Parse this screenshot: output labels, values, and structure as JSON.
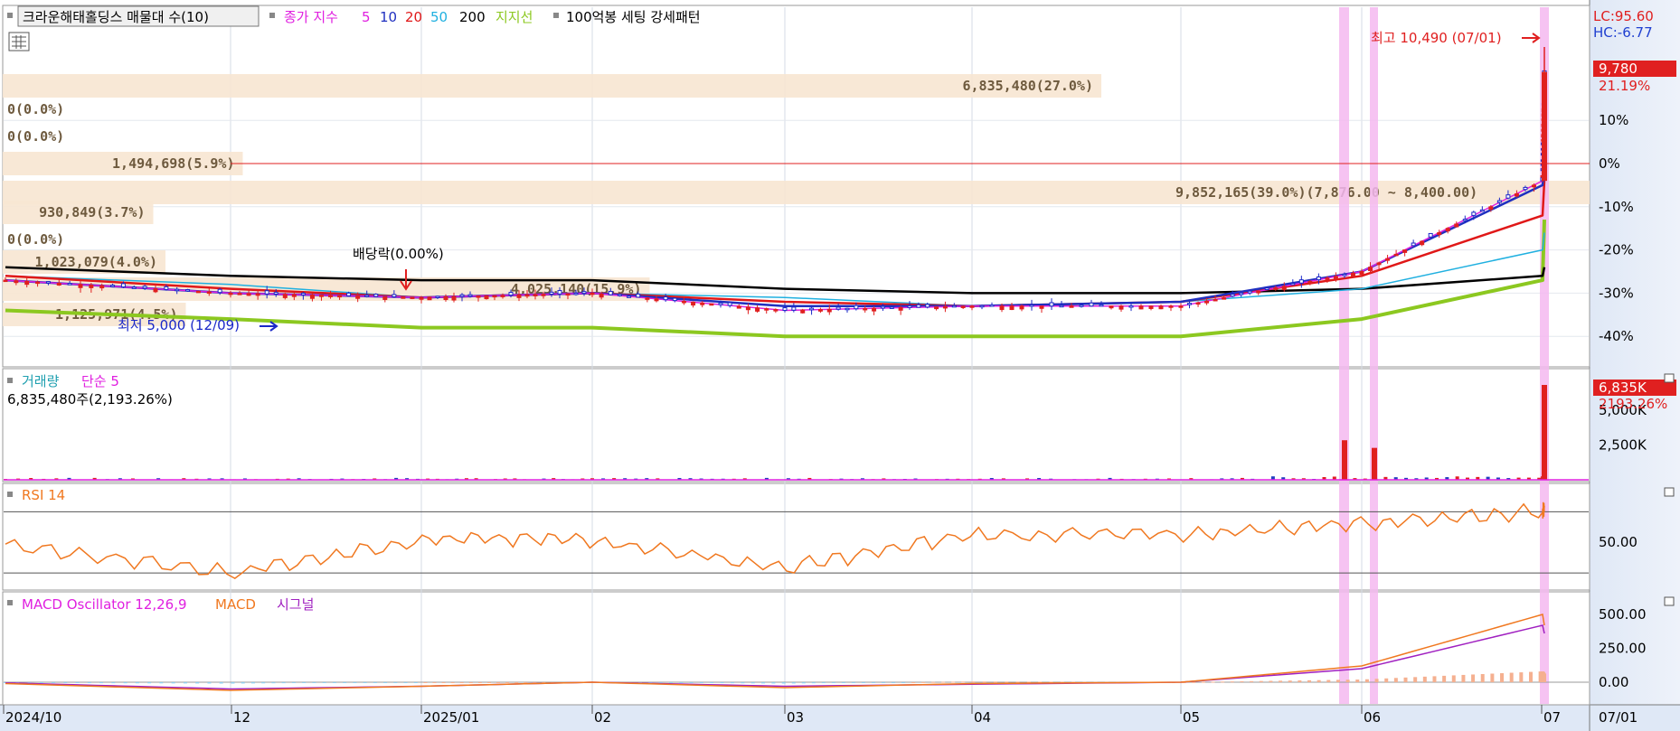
{
  "header": {
    "stock_name": "크라운해태홀딩스 매물대 수(10)",
    "ma_label": "종가 지수",
    "ma_periods": [
      {
        "label": "5",
        "color": "#e020e0"
      },
      {
        "label": "10",
        "color": "#2030c0"
      },
      {
        "label": "20",
        "color": "#e01818"
      },
      {
        "label": "50",
        "color": "#20b0e0"
      },
      {
        "label": "200",
        "color": "#000000"
      }
    ],
    "support_label": "지지선",
    "support_color": "#8cc820",
    "pattern_label": "100억봉 세팅 강세패턴"
  },
  "price_panel": {
    "lc_label": "LC:95.60",
    "hc_label": "HC:-6.77",
    "current_price": "9,780",
    "current_pct": "21.19%",
    "high_note": "최고 10,490 (07/01)",
    "low_note": "최저 5,000 (12/09)",
    "dividend_note": "배당락(0.00%)",
    "pct_ticks": [
      {
        "label": "10%",
        "v": 10
      },
      {
        "label": "0%",
        "v": 0
      },
      {
        "label": "-10%",
        "v": -10
      },
      {
        "label": "-20%",
        "v": -20
      },
      {
        "label": "-30%",
        "v": -30
      },
      {
        "label": "-40%",
        "v": -40
      }
    ],
    "volume_profile": [
      {
        "label": "6,835,480(27.0%)",
        "pct": 27.0
      },
      {
        "label": "0(0.0%)",
        "pct": 0.0
      },
      {
        "label": "0(0.0%)",
        "pct": 0.0
      },
      {
        "label": "1,494,698(5.9%)",
        "pct": 5.9
      },
      {
        "label": "9,852,165(39.0%)(7,876.00 ~ 8,400.00)",
        "pct": 39.0
      },
      {
        "label": "930,849(3.7%)",
        "pct": 3.7
      },
      {
        "label": "0(0.0%)",
        "pct": 0.0
      },
      {
        "label": "1,023,079(4.0%)",
        "pct": 4.0
      },
      {
        "label": "4,025,140(15.9%)",
        "pct": 15.9
      },
      {
        "label": "1,125,971(4.5%)",
        "pct": 4.5
      }
    ]
  },
  "volume_panel": {
    "title": "거래량",
    "ma_label": "단순 5",
    "value_text": "6,835,480주(2,193.26%)",
    "last_value": "6,835K",
    "last_pct": "2193.26%",
    "ticks": [
      {
        "label": "5,000K",
        "v": 5000
      },
      {
        "label": "2,500K",
        "v": 2500
      }
    ]
  },
  "rsi_panel": {
    "title": "RSI 14",
    "ticks": [
      {
        "label": "50.00",
        "v": 50
      }
    ]
  },
  "macd_panel": {
    "osc_label": "MACD Oscillator 12,26,9",
    "macd_label": "MACD",
    "signal_label": "시그널",
    "ticks": [
      {
        "label": "500.00",
        "v": 500
      },
      {
        "label": "250.00",
        "v": 250
      },
      {
        "label": "0.00",
        "v": 0
      }
    ]
  },
  "x_axis": {
    "labels": [
      "2024/10",
      "12",
      "2025/01",
      "02",
      "03",
      "04",
      "05",
      "06",
      "07"
    ],
    "right_label": "07/01"
  },
  "chart_data": {
    "type": "candlestick",
    "title": "크라운해태홀딩스",
    "x_range": [
      "2024/10",
      "2025/07/01"
    ],
    "price_pct_ylim": [
      -45,
      20
    ],
    "price_pct_ref_0": 8070,
    "price_series": {
      "months": [
        "2024/10",
        "2024/11",
        "2024/12",
        "2025/01",
        "2025/02",
        "2025/03",
        "2025/04",
        "2025/05",
        "2025/06",
        "2025/07"
      ],
      "close_pct": [
        -27,
        -30,
        -31,
        -30,
        -34,
        -33,
        -33,
        -25,
        -4,
        21
      ],
      "ma5_pct": [
        -27,
        -30,
        -31,
        -30,
        -33,
        -33,
        -32,
        -25,
        -5,
        0
      ],
      "ma20_pct": [
        -26,
        -29,
        -31,
        -30,
        -32,
        -33,
        -32,
        -26,
        -12,
        -4
      ],
      "ma50_pct": [
        -26,
        -28,
        -31,
        -30,
        -31,
        -33,
        -32,
        -29,
        -20,
        -16
      ],
      "ma200_pct": [
        -24,
        -26,
        -27,
        -27,
        -29,
        -30,
        -30,
        -29,
        -26,
        -24
      ],
      "support_pct": [
        -34,
        -36,
        -38,
        -38,
        -40,
        -40,
        -40,
        -36,
        -27,
        -13
      ]
    },
    "volume_series": {
      "unit": "K shares",
      "ylim": [
        0,
        6900
      ],
      "ma5_last": 300,
      "spikes": [
        {
          "date": "2025/05/28",
          "v": 2850
        },
        {
          "date": "2025/06/04",
          "v": 2300
        },
        {
          "date": "2025/07/01",
          "v": 6835
        }
      ]
    },
    "rsi_series": {
      "ylim": [
        20,
        85
      ],
      "overbought": 70,
      "oversold": 30,
      "months": [
        "2024/10",
        "2024/11",
        "2024/12",
        "2025/01",
        "2025/02",
        "2025/03",
        "2025/04",
        "2025/05",
        "2025/06",
        "2025/07"
      ],
      "values": [
        48,
        30,
        52,
        52,
        33,
        55,
        55,
        63,
        70,
        72
      ]
    },
    "macd_series": {
      "ylim": [
        -100,
        560
      ],
      "months": [
        "2024/10",
        "2024/11",
        "2024/12",
        "2025/01",
        "2025/02",
        "2025/03",
        "2025/04",
        "2025/05",
        "2025/06",
        "2025/07"
      ],
      "macd": [
        -10,
        -60,
        -30,
        0,
        -40,
        -10,
        0,
        120,
        500,
        420
      ],
      "signal": [
        -5,
        -50,
        -30,
        0,
        -30,
        -15,
        0,
        100,
        420,
        360
      ]
    }
  }
}
